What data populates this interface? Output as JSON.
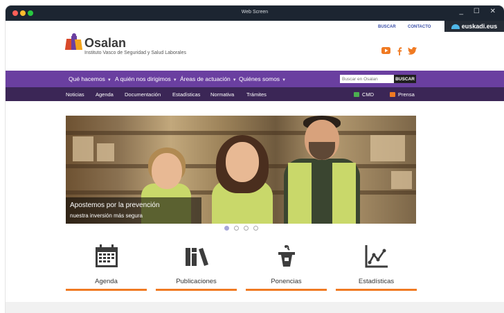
{
  "window": {
    "title": "Web Screen"
  },
  "topbar": {
    "search_link": "BUSCAR",
    "contact_link": "CONTACTO",
    "euskadi": "euskadi.eus"
  },
  "brand": {
    "name": "Osalan",
    "tagline": "Instituto Vasco de Seguridad y Salud Laborales"
  },
  "social": {
    "youtube": "youtube-icon",
    "facebook": "facebook-icon",
    "twitter": "twitter-icon",
    "accent": "#f07a22"
  },
  "nav_primary": {
    "items": [
      {
        "label": "Qué hacemos"
      },
      {
        "label": "A quién nos dirigimos"
      },
      {
        "label": "Áreas de actuación"
      },
      {
        "label": "Quiénes somos"
      }
    ],
    "search_placeholder": "Buscar en Osalan",
    "search_button": "BUSCAR",
    "color": "#6a3fa0"
  },
  "nav_secondary": {
    "items": [
      {
        "label": "Noticias"
      },
      {
        "label": "Agenda"
      },
      {
        "label": "Documentación"
      },
      {
        "label": "Estadísticas"
      },
      {
        "label": "Normativa"
      },
      {
        "label": "Trámites"
      }
    ],
    "cmd": "CMD",
    "prensa": "Prensa",
    "color": "#3b2656"
  },
  "hero": {
    "headline": "Apostemos por la prevención",
    "subline": "nuestra inversión más segura",
    "slides": 4,
    "active_slide": 1
  },
  "tiles": [
    {
      "label": "Agenda",
      "icon": "calendar-icon"
    },
    {
      "label": "Publicaciones",
      "icon": "books-icon"
    },
    {
      "label": "Ponencias",
      "icon": "podium-icon"
    },
    {
      "label": "Estadísticas",
      "icon": "chart-icon"
    }
  ]
}
